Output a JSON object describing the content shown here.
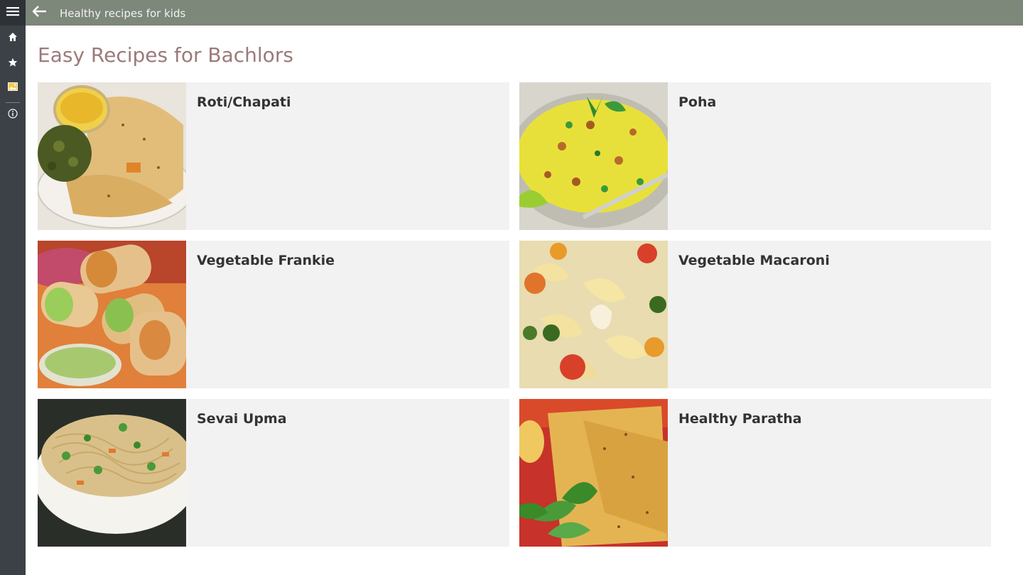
{
  "app": {
    "title": "Healthy recipes for kids"
  },
  "sidebar": {
    "items": [
      {
        "icon": "hamburger-menu-icon"
      },
      {
        "icon": "home-icon"
      },
      {
        "icon": "star-icon"
      },
      {
        "icon": "image-icon"
      },
      {
        "icon": "info-icon"
      }
    ]
  },
  "page": {
    "title": "Easy Recipes for Bachlors"
  },
  "recipes": [
    {
      "name": "Roti/Chapati"
    },
    {
      "name": "Poha"
    },
    {
      "name": "Vegetable Frankie"
    },
    {
      "name": "Vegetable Macaroni"
    },
    {
      "name": "Sevai Upma"
    },
    {
      "name": "Healthy Paratha"
    }
  ],
  "colors": {
    "topbar": "#7d877a",
    "sidebar": "#3b4147",
    "title": "#9c7a7a",
    "card": "#f2f2f2"
  }
}
